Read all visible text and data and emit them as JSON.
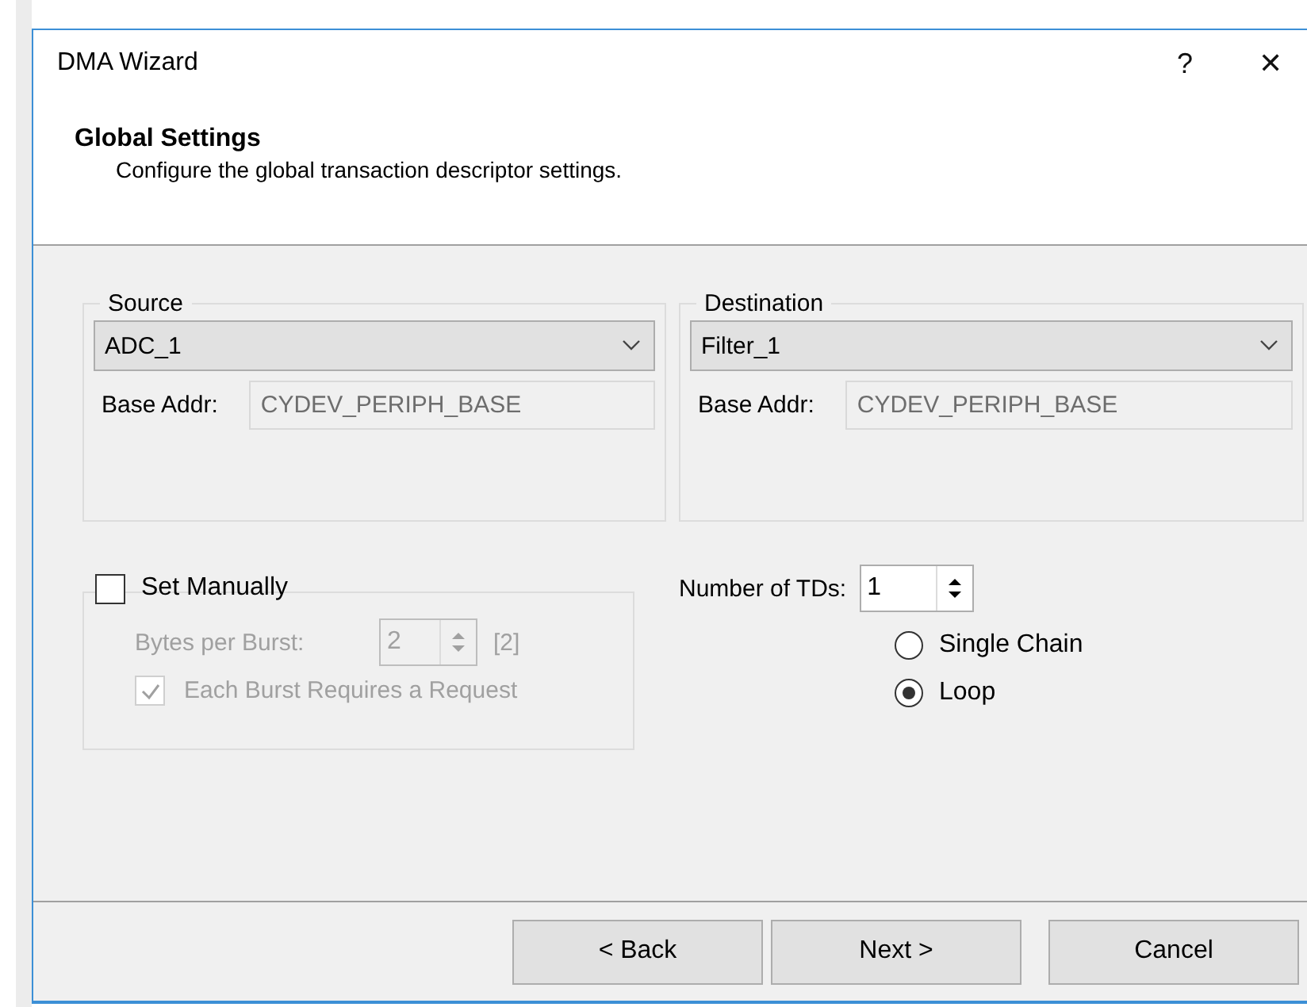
{
  "window": {
    "title": "DMA Wizard",
    "help": "?",
    "close": "✕"
  },
  "header": {
    "title": "Global Settings",
    "subtitle": "Configure the global transaction descriptor settings."
  },
  "groups": [
    {
      "label": "Source",
      "value": "ADC_1",
      "base_addr_label": "Base Addr:",
      "base_addr": "CYDEV_PERIPH_BASE",
      "disabled": true
    },
    {
      "label": "Destination",
      "value": "Filter_1",
      "base_addr_label": "Base Addr:",
      "base_addr": "CYDEV_PERIPH_BASE",
      "disabled": true
    }
  ],
  "set_manually": {
    "label": "Set Manually",
    "checked": false,
    "bytes_label": "Bytes per Burst:",
    "bytes_value": "2",
    "bytes_hint": "[2]",
    "each_burst": {
      "label": "Each Burst Requires a Request",
      "checked": true
    }
  },
  "tds": {
    "label": "Number of TDs:",
    "value": "1",
    "modes": [
      {
        "label": "Single Chain",
        "selected": false
      },
      {
        "label": "Loop",
        "selected": true
      }
    ]
  },
  "buttons": [
    {
      "label": "< Back"
    },
    {
      "label": "Next >"
    },
    {
      "label": "Cancel"
    }
  ]
}
